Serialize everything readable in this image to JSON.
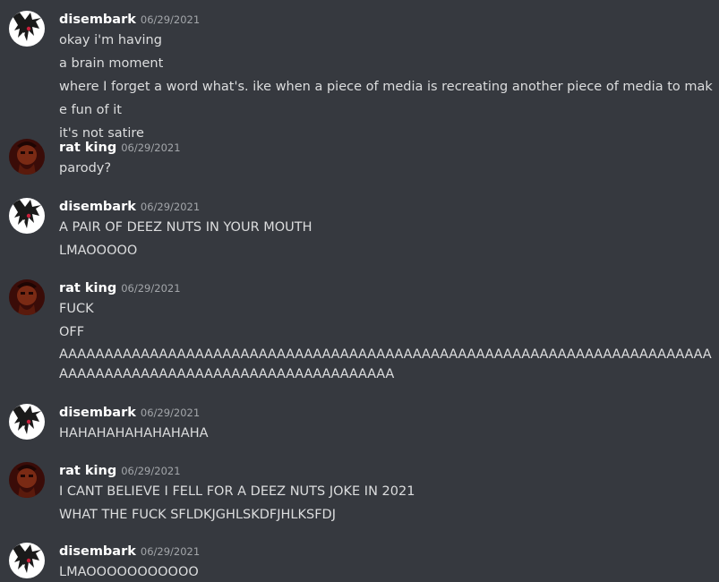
{
  "users": {
    "disembark": {
      "name": "disembark",
      "avatar_icon": "anime-portrait-avatar-icon"
    },
    "rat_king": {
      "name": "rat king",
      "avatar_icon": "dark-red-portrait-avatar-icon"
    }
  },
  "messages": [
    {
      "author": "disembark",
      "timestamp": "06/29/2021",
      "lines": [
        "okay i'm having",
        "a brain moment",
        "where I forget a word what's. ike when a piece of media is recreating another piece of media to make fun of it",
        "it's not satire"
      ]
    },
    {
      "author": "rat king",
      "timestamp": "06/29/2021",
      "lines": [
        "parody?"
      ]
    },
    {
      "author": "disembark",
      "timestamp": "06/29/2021",
      "lines": [
        "A PAIR OF DEEZ NUTS IN YOUR MOUTH",
        "LMAOOOOO"
      ]
    },
    {
      "author": "rat king",
      "timestamp": "06/29/2021",
      "lines": [
        "FUCK",
        "OFF",
        "AAAAAAAAAAAAAAAAAAAAAAAAAAAAAAAAAAAAAAAAAAAAAAAAAAAAAAAAAAAAAAAAAAAAAAAAAAAAAAAAAAAAAAAAAAAAAAAAAAAAAAAAAAAAA"
      ]
    },
    {
      "author": "disembark",
      "timestamp": "06/29/2021",
      "lines": [
        "HAHAHAHAHAHAHAHA"
      ]
    },
    {
      "author": "rat king",
      "timestamp": "06/29/2021",
      "lines": [
        "I CANT BELIEVE I FELL FOR A DEEZ NUTS JOKE IN 2021",
        "WHAT THE FUCK SFLDKJGHLSKDFJHLKSFDJ"
      ]
    },
    {
      "author": "disembark",
      "timestamp": "06/29/2021",
      "lines": [
        "LMAOOOOOOOOOOO"
      ]
    }
  ],
  "colors": {
    "background": "#36393f",
    "username": "#ffffff",
    "timestamp": "#a3a6aa",
    "text": "#dcddde"
  }
}
